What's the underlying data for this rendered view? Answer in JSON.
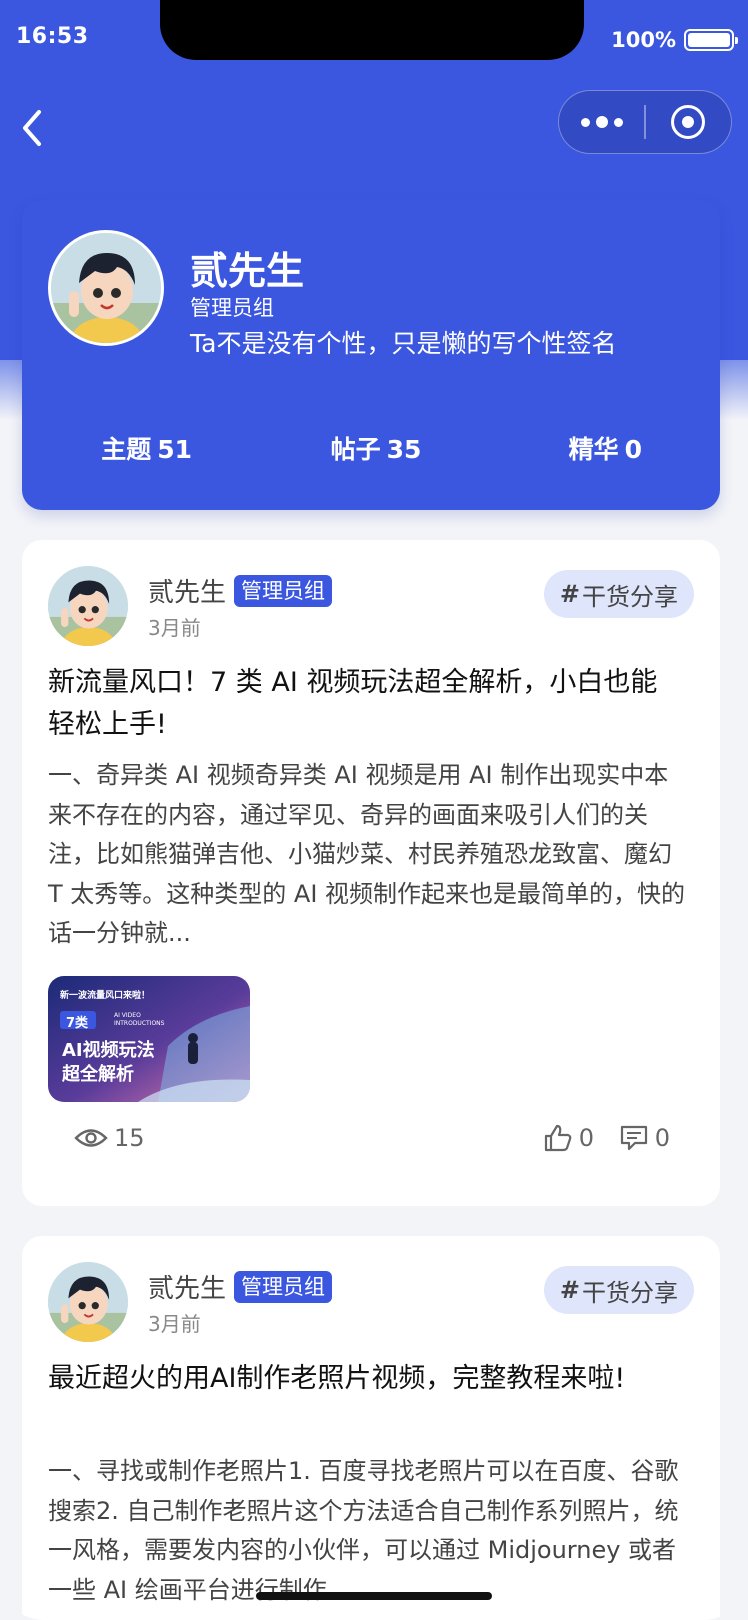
{
  "status_bar": {
    "time": "16:53",
    "battery": "100%"
  },
  "profile": {
    "name": "贰先生",
    "group": "管理员组",
    "signature": "Ta不是没有个性，只是懒的写个性签名",
    "stats": [
      {
        "label": "主题",
        "value": "51"
      },
      {
        "label": "帖子",
        "value": "35"
      },
      {
        "label": "精华",
        "value": "0"
      }
    ]
  },
  "posts": [
    {
      "author": "贰先生",
      "badge": "管理员组",
      "time": "3月前",
      "tag": "干货分享",
      "title": "新流量风口！7 类 AI 视频玩法超全解析，小白也能轻松上手!",
      "excerpt": "一、奇异类 AI 视频奇异类 AI 视频是用 AI 制作出现实中本来不存在的内容，通过罕见、奇异的画面来吸引人们的关注，比如熊猫弹吉他、小猫炒菜、村民养殖恐龙致富、魔幻 T 太秀等。这种类型的 AI 视频制作起来也是最简单的，快的话一分钟就...",
      "thumbnail": {
        "headline": "新一波流量风口来啦！",
        "badge": "7类",
        "subtitle": "AI VIDEO INTRODUCTIONS",
        "line1": "AI视频玩法",
        "line2": "超全解析"
      },
      "views": "15",
      "likes": "0",
      "comments": "0"
    },
    {
      "author": "贰先生",
      "badge": "管理员组",
      "time": "3月前",
      "tag": "干货分享",
      "title": "最近超火的用AI制作老照片视频，完整教程来啦!",
      "excerpt": "一、寻找或制作老照片1. 百度寻找老照片可以在百度、谷歌搜索2. 自己制作老照片这个方法适合自己制作系列照片，统一风格，需要发内容的小伙伴，可以通过 Midjourney 或者一些 AI 绘画平台进行制作"
    }
  ],
  "colors": {
    "accent": "#3b57e0",
    "tag_bg": "#dfe5fb",
    "page_bg": "#f3f4f8"
  }
}
